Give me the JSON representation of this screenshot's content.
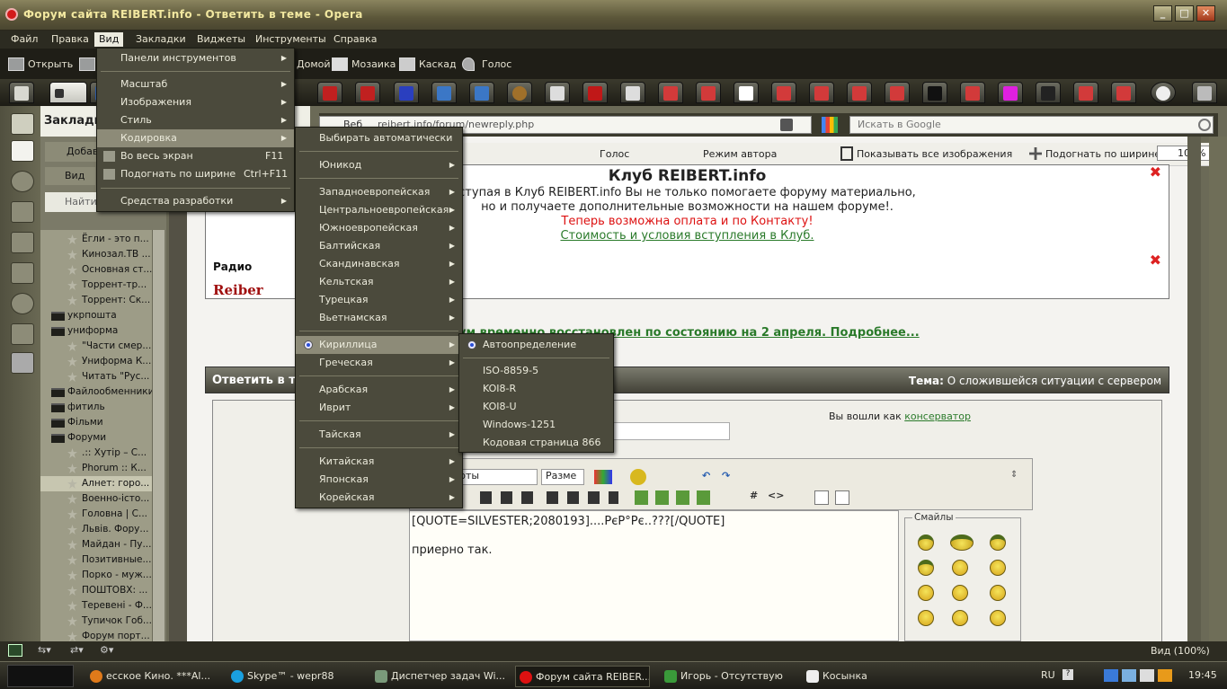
{
  "window": {
    "title": "Форум сайта REIBERT.info - Ответить в теме - Opera",
    "controls": [
      "_",
      "□",
      "✕"
    ]
  },
  "menubar": {
    "items": [
      "Файл",
      "Правка",
      "Вид",
      "Закладки",
      "Виджеты",
      "Инструменты",
      "Справка"
    ],
    "active": "Вид"
  },
  "toolbar": {
    "open": "Открыть",
    "home": "Домой",
    "mosaic": "Мозаика",
    "cascade": "Каскад",
    "voice": "Голос"
  },
  "tabs": {
    "count": 25
  },
  "address": {
    "url": "reibert.info/forum/newreply.php",
    "prefix": "Веб",
    "search_placeholder": "Искать в Google"
  },
  "panel": {
    "title": "Закладк",
    "add": "Добав",
    "view": "Вид",
    "find": "Найти"
  },
  "bookmarks": [
    {
      "label": "Ёгли - это п...",
      "type": "bookmark"
    },
    {
      "label": "Кинозал.ТВ ...",
      "type": "bookmark"
    },
    {
      "label": "Основная ст...",
      "type": "bookmark"
    },
    {
      "label": "Торрент-тр...",
      "type": "bookmark"
    },
    {
      "label": "Торрент: Ск...",
      "type": "bookmark"
    },
    {
      "label": "укрпошта",
      "type": "folder"
    },
    {
      "label": "униформа",
      "type": "folder"
    },
    {
      "label": "\"Части смер...",
      "type": "bookmark"
    },
    {
      "label": "Униформа К...",
      "type": "bookmark"
    },
    {
      "label": "Читать \"Рус...",
      "type": "bookmark"
    },
    {
      "label": "Файлообменники",
      "type": "folder"
    },
    {
      "label": "фитиль",
      "type": "folder"
    },
    {
      "label": "Фільми",
      "type": "folder"
    },
    {
      "label": "Форуми",
      "type": "folder"
    },
    {
      "label": ".:: Хутір – С...",
      "type": "bookmark"
    },
    {
      "label": "Phorum :: К...",
      "type": "bookmark"
    },
    {
      "label": "Алнет: горо...",
      "type": "bookmark"
    },
    {
      "label": "Военно-істо...",
      "type": "bookmark"
    },
    {
      "label": "Головна | С...",
      "type": "bookmark"
    },
    {
      "label": "Львів. Фору...",
      "type": "bookmark"
    },
    {
      "label": "Майдан - Пу...",
      "type": "bookmark"
    },
    {
      "label": "Позитивные...",
      "type": "bookmark"
    },
    {
      "label": "Порко - муж...",
      "type": "bookmark"
    },
    {
      "label": "ПОШТОВХ: ...",
      "type": "bookmark"
    },
    {
      "label": "Теревені - Ф...",
      "type": "bookmark"
    },
    {
      "label": "Тупичок Гоб...",
      "type": "bookmark"
    },
    {
      "label": "Форум порт...",
      "type": "bookmark"
    }
  ],
  "browser_tools": {
    "voice": "Голос",
    "author_mode": "Режим автора",
    "show_images": "Показывать все изображения",
    "fit_width": "Подогнать по ширине",
    "zoom": "100%"
  },
  "promo": {
    "title": "Клуб REIBERT.info",
    "line1": "ступая в Клуб REIBERT.info Вы не только помогаете форуму материально,",
    "line2": "но и получаете дополнительные возможности на нашем форуме!.",
    "line3": "Теперь возможна оплата и по Контакту!",
    "line4": "Стоимость и условия вступления в Клуб.",
    "radio": "Радио",
    "radio_logo": "Reiber"
  },
  "notice": "ум временно восстановлен по состоянию на 2 апреля. Подробнее...",
  "reply": {
    "title": "Ответить в т",
    "topic_label": "Тема:",
    "topic": "О сложившейся ситуации с сервером",
    "logged_in": "Вы вошли как",
    "user": "консерватор",
    "font_select": "рты",
    "size_select": "Разме",
    "editor_line1": "[QUOTE=SILVESTER;2080193]....РєР°Рє..???[/QUOTE]",
    "editor_line2": "приерно так.",
    "smilies_label": "Смайлы"
  },
  "statusbar": {
    "zoom": "Вид (100%)"
  },
  "taskbar": {
    "tasks": [
      "ecское Кино. ***Al...",
      "Skype™ - wepr88",
      "Диспетчер задач Wi...",
      "Форум сайта REIBER...",
      "Игорь - Отсутствую",
      "Косынка"
    ],
    "lang": "RU",
    "time": "19:45"
  },
  "view_menu": [
    {
      "label": "Панели инструментов",
      "arrow": true
    },
    {
      "label": "Масштаб",
      "arrow": true
    },
    {
      "label": "Изображения",
      "arrow": true
    },
    {
      "label": "Стиль",
      "arrow": true
    },
    {
      "label": "Кодировка",
      "arrow": true,
      "highlighted": true
    },
    {
      "label": "Во весь экран",
      "shortcut": "F11"
    },
    {
      "label": "Подогнать по ширине",
      "shortcut": "Ctrl+F11"
    },
    {
      "label": "Средства разработки",
      "arrow": true
    }
  ],
  "encoding_menu": [
    {
      "label": "Выбирать автоматически"
    },
    {
      "label": "Юникод",
      "arrow": true
    },
    {
      "label": "Западноевропейская",
      "arrow": true
    },
    {
      "label": "Центральноевропейская",
      "arrow": true
    },
    {
      "label": "Южноевропейская",
      "arrow": true
    },
    {
      "label": "Балтийская",
      "arrow": true
    },
    {
      "label": "Скандинавская",
      "arrow": true
    },
    {
      "label": "Кельтская",
      "arrow": true
    },
    {
      "label": "Турецкая",
      "arrow": true
    },
    {
      "label": "Вьетнамская",
      "arrow": true
    },
    {
      "label": "Кириллица",
      "arrow": true,
      "highlighted": true,
      "checked": true
    },
    {
      "label": "Греческая",
      "arrow": true
    },
    {
      "label": "Арабская",
      "arrow": true
    },
    {
      "label": "Иврит",
      "arrow": true
    },
    {
      "label": "Тайская",
      "arrow": true
    },
    {
      "label": "Китайская",
      "arrow": true
    },
    {
      "label": "Японская",
      "arrow": true
    },
    {
      "label": "Корейская",
      "arrow": true
    }
  ],
  "cyrillic_menu": [
    {
      "label": "Автоопределение",
      "checked": true
    },
    {
      "label": "ISO-8859-5"
    },
    {
      "label": "KOI8-R"
    },
    {
      "label": "KOI8-U"
    },
    {
      "label": "Windows-1251"
    },
    {
      "label": "Кодовая страница 866"
    }
  ]
}
